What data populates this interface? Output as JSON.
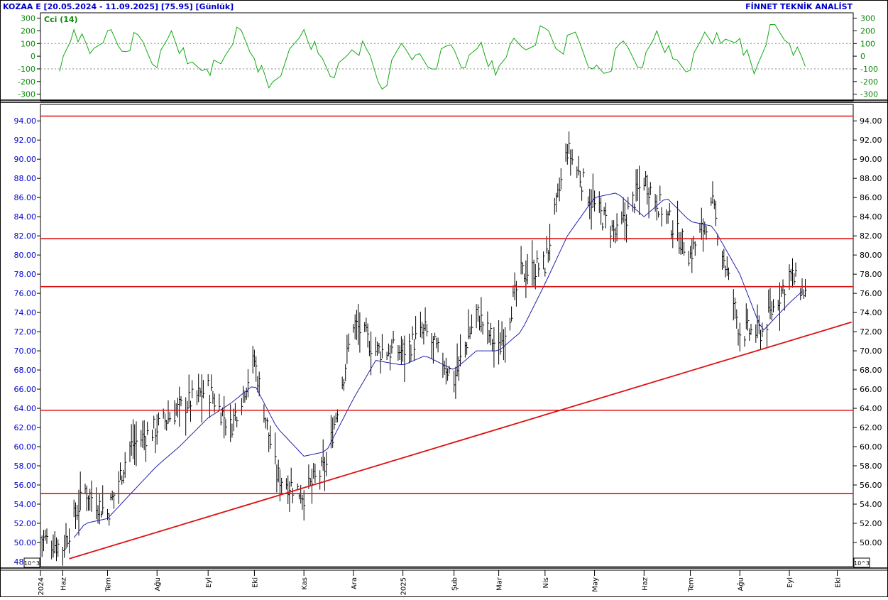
{
  "header": {
    "left": "KOZAA E  [20.05.2024 - 11.09.2025]  [75.95]  [Günlük]",
    "right": "FİNNET TEKNİK ANALİST"
  },
  "cci_panel": {
    "label": "Cci (14)",
    "ticks": [
      300,
      200,
      100,
      0,
      -100,
      -200,
      -300
    ],
    "ylim": [
      -330,
      320
    ],
    "ref_lines": [
      100,
      -100
    ]
  },
  "price_panel": {
    "ticks": [
      "94.00",
      "92.00",
      "90.00",
      "88.00",
      "86.00",
      "84.00",
      "82.00",
      "80.00",
      "78.00",
      "76.00",
      "74.00",
      "72.00",
      "70.00",
      "68.00",
      "66.00",
      "64.00",
      "62.00",
      "60.00",
      "58.00",
      "56.00",
      "54.00",
      "52.00",
      "50.00",
      "48.00"
    ],
    "tick_values": [
      94,
      92,
      90,
      88,
      86,
      84,
      82,
      80,
      78,
      76,
      74,
      72,
      70,
      68,
      66,
      64,
      62,
      60,
      58,
      56,
      54,
      52,
      50,
      48
    ],
    "right_ticks": [
      "94.00",
      "92.00",
      "90.00",
      "88.00",
      "86.00",
      "84.00",
      "82.00",
      "80.00",
      "78.00",
      "76.00",
      "74.00",
      "72.00",
      "70.00",
      "68.00",
      "66.00",
      "64.00",
      "62.00",
      "60.00",
      "58.00",
      "56.00",
      "54.00",
      "52.00",
      "50.00",
      "00"
    ],
    "scale_tag": "10^3",
    "ylim": [
      47.7,
      95.5
    ]
  },
  "x_axis": {
    "labels": [
      "2024",
      "Haz",
      "Tem",
      "Ağu",
      "Eyl",
      "Eki",
      "Kas",
      "Ara",
      "2025",
      "Şub",
      "Mar",
      "Nis",
      "May",
      "Haz",
      "Tem",
      "Ağu",
      "Eyl",
      "Eki"
    ],
    "dates": [
      "2024-05-20",
      "2024-06-03",
      "2024-07-01",
      "2024-08-01",
      "2024-09-02",
      "2024-10-01",
      "2024-11-01",
      "2024-12-02",
      "2025-01-02",
      "2025-02-03",
      "2025-03-03",
      "2025-04-01",
      "2025-05-02",
      "2025-06-02",
      "2025-07-01",
      "2025-08-01",
      "2025-09-01",
      "2025-10-01"
    ]
  },
  "chart_data": [
    {
      "type": "line",
      "title": "Cci (14)",
      "x": [
        "2024-06-01",
        "2024-06-10",
        "2024-06-20",
        "2024-07-01",
        "2024-07-10",
        "2024-07-20",
        "2024-08-01",
        "2024-08-10",
        "2024-08-20",
        "2024-09-01",
        "2024-09-10",
        "2024-09-20",
        "2024-10-01",
        "2024-10-10",
        "2024-10-20",
        "2024-11-01",
        "2024-11-10",
        "2024-11-20",
        "2024-12-01",
        "2024-12-10",
        "2024-12-20",
        "2025-01-01",
        "2025-01-10",
        "2025-01-20",
        "2025-02-01",
        "2025-02-10",
        "2025-02-20",
        "2025-03-01",
        "2025-03-10",
        "2025-03-20",
        "2025-04-01",
        "2025-04-10",
        "2025-04-20",
        "2025-05-01",
        "2025-05-10",
        "2025-05-20",
        "2025-06-01",
        "2025-06-10",
        "2025-06-20",
        "2025-07-01",
        "2025-07-10",
        "2025-07-20",
        "2025-08-01",
        "2025-08-10",
        "2025-08-20",
        "2025-09-01",
        "2025-09-11"
      ],
      "values": [
        -120,
        210,
        20,
        200,
        40,
        170,
        -90,
        200,
        -60,
        -100,
        -60,
        230,
        -20,
        -250,
        -60,
        210,
        20,
        -170,
        50,
        60,
        -260,
        100,
        10,
        -100,
        90,
        -90,
        110,
        -150,
        90,
        50,
        220,
        40,
        190,
        -100,
        -130,
        120,
        -90,
        200,
        -20,
        -110,
        190,
        100,
        140,
        -140,
        250,
        100,
        -80
      ],
      "ylim": [
        -330,
        320
      ],
      "ref_lines": [
        100,
        -100
      ]
    },
    {
      "type": "ohlc",
      "x": [
        "2024-05-20",
        "2024-06-03",
        "2024-06-17",
        "2024-07-01",
        "2024-07-15",
        "2024-08-01",
        "2024-08-15",
        "2024-09-02",
        "2024-09-16",
        "2024-10-01",
        "2024-10-15",
        "2024-11-01",
        "2024-11-15",
        "2024-12-02",
        "2024-12-16",
        "2025-01-02",
        "2025-01-16",
        "2025-02-03",
        "2025-02-17",
        "2025-03-03",
        "2025-03-17",
        "2025-04-01",
        "2025-04-15",
        "2025-05-02",
        "2025-05-16",
        "2025-06-02",
        "2025-06-16",
        "2025-07-01",
        "2025-07-15",
        "2025-08-01",
        "2025-08-15",
        "2025-09-01",
        "2025-09-11"
      ],
      "values": [
        50.5,
        49.5,
        55.5,
        53,
        60,
        62,
        64,
        66,
        62,
        69,
        57,
        55,
        58,
        73,
        70,
        70,
        72,
        67,
        74,
        70,
        78,
        79,
        91,
        85,
        82,
        88,
        84,
        80,
        85,
        72,
        72,
        78,
        76
      ],
      "series": [
        {
          "name": "",
          "values": [
            48.5,
            49,
            52,
            52.5,
            55,
            58,
            60,
            63,
            64.5,
            66.5,
            62,
            59,
            59.5,
            65,
            69,
            68.5,
            69.5,
            68,
            70,
            70,
            72,
            77,
            82,
            86,
            86.5,
            84,
            86,
            83.5,
            83,
            78,
            72,
            75,
            76.5
          ]
        }
      ],
      "ylim": [
        47.7,
        95.5
      ]
    }
  ],
  "levels": {
    "resistance": [
      94.5,
      81.7,
      76.7,
      63.8,
      55.1
    ],
    "trendline": {
      "from_date": "2024-06-07",
      "from_value": 48.3,
      "to_date": "2025-10-10",
      "to_value": 73.0
    }
  },
  "colors": {
    "axis_text_blue": "#0000cc",
    "level_red": "#dd1111",
    "cci_green": "#11aa11",
    "ma_blue": "#2222aa",
    "bars": "#000000"
  }
}
